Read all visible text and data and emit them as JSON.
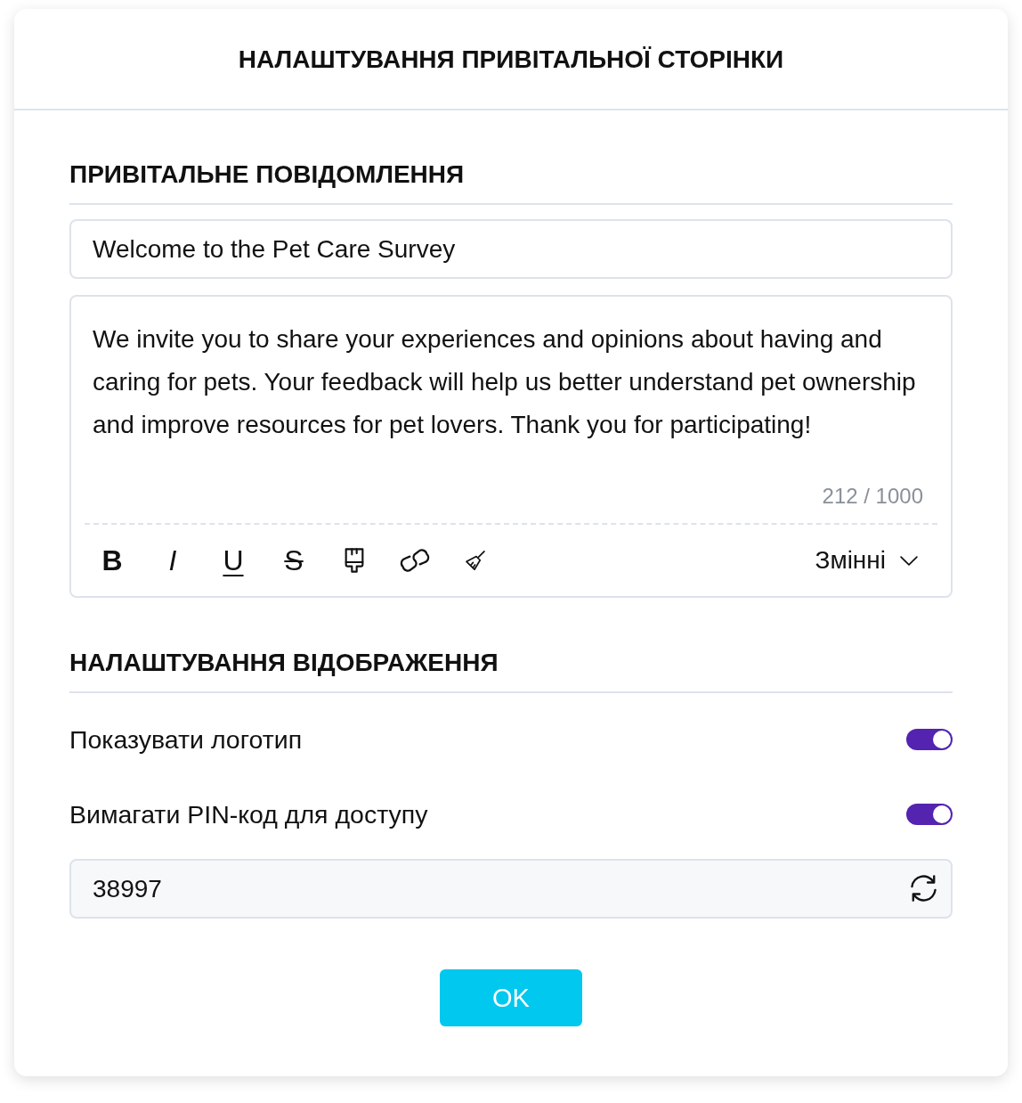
{
  "dialog": {
    "title": "НАЛАШТУВАННЯ ПРИВІТАЛЬНОЇ СТОРІНКИ"
  },
  "welcome_message": {
    "heading": "ПРИВІТАЛЬНЕ ПОВІДОМЛЕННЯ",
    "title_field": {
      "value": "Welcome to the Pet Care Survey"
    },
    "editor": {
      "value": "We invite you to share your experiences and opinions about having and caring for pets. Your feedback will help us better understand pet ownership and improve resources for pet lovers. Thank you for participating!",
      "counter": "212 / 1000",
      "toolbar": [
        {
          "kind": "bold",
          "label": "B"
        },
        {
          "kind": "italic",
          "label": "I"
        },
        {
          "kind": "underline",
          "label": "U"
        },
        {
          "kind": "strike",
          "label": "S"
        },
        {
          "kind": "painter"
        },
        {
          "kind": "link"
        },
        {
          "kind": "clear"
        }
      ],
      "variables_menu": {
        "label": "Змінні"
      }
    }
  },
  "display_settings": {
    "heading": "НАЛАШТУВАННЯ ВІДОБРАЖЕННЯ",
    "options": [
      {
        "label": "Показувати логотип",
        "on": true
      },
      {
        "label": "Вимагати PIN-код для доступу",
        "on": true
      }
    ],
    "pin_field": {
      "value": "38997"
    }
  },
  "buttons": [
    {
      "label": "OK"
    }
  ]
}
